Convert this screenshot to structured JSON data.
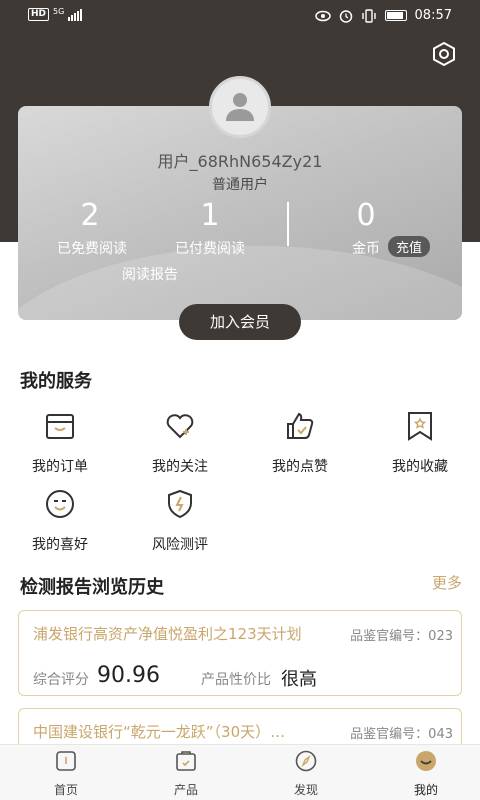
{
  "status_bar": {
    "network_badge": "HD",
    "network_type": "5G",
    "time": "08:57"
  },
  "profile": {
    "username": "用户_68RhN654Zy21",
    "user_type": "普通用户",
    "free_reads": "2",
    "free_reads_label": "已免费阅读",
    "paid_reads": "1",
    "paid_reads_label": "已付费阅读",
    "coins": "0",
    "coins_label": "金币",
    "recharge_label": "充值",
    "report_label": "阅读报告",
    "join_label": "加入会员"
  },
  "services": {
    "title": "我的服务",
    "items": [
      {
        "label": "我的订单",
        "icon": "box-icon"
      },
      {
        "label": "我的关注",
        "icon": "heart-icon"
      },
      {
        "label": "我的点赞",
        "icon": "thumb-up-icon"
      },
      {
        "label": "我的收藏",
        "icon": "bookmark-icon"
      },
      {
        "label": "我的喜好",
        "icon": "smiley-icon"
      },
      {
        "label": "风险测评",
        "icon": "shield-lightning-icon"
      }
    ]
  },
  "history": {
    "title": "检测报告浏览历史",
    "more_label": "更多",
    "items": [
      {
        "title": "浦发银行高资产净值悦盈利之123天计划",
        "code": "品鉴官编号：023",
        "score_label": "综合评分",
        "score": "90.96",
        "value_label": "产品性价比",
        "value": "很高"
      },
      {
        "title": "中国建设银行“乾元一龙跃”（30天）…",
        "code": "品鉴官编号：043"
      }
    ]
  },
  "tabs": [
    {
      "label": "首页",
      "icon": "home-icon"
    },
    {
      "label": "产品",
      "icon": "bag-icon"
    },
    {
      "label": "发现",
      "icon": "compass-icon"
    },
    {
      "label": "我的",
      "icon": "profile-smile-icon"
    }
  ],
  "colors": {
    "header_bg": "#3f3936",
    "accent_gold": "#c9a66b",
    "join_button": "#3e3935"
  }
}
